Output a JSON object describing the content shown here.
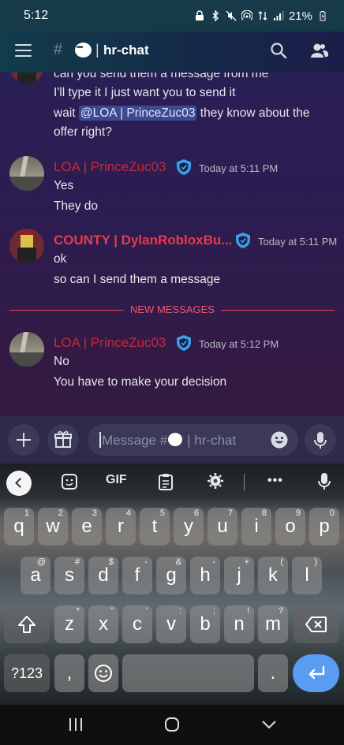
{
  "status_bar": {
    "time": "5:12",
    "battery": "21%"
  },
  "header": {
    "channel_name": "hr-chat",
    "separator": "|"
  },
  "chat": {
    "prev_lines": [
      "can you send them a message from me",
      "I'll type it I just want you to send it",
      "wait",
      "@LOA | PrinceZuc03",
      "they know about the",
      "offer right?"
    ],
    "messages": [
      {
        "author": "LOA | PrinceZuc03",
        "time": "Today at 5:11 PM",
        "lines": [
          "Yes",
          "They do"
        ]
      },
      {
        "author": "COUNTY | DylanRobloxBu...",
        "time": "Today at 5:11 PM",
        "lines": [
          "ok",
          "so can I send them a message"
        ]
      },
      {
        "author": "LOA | PrinceZuc03",
        "time": "Today at 5:12 PM",
        "lines": [
          "No",
          "You have to make your decision"
        ]
      }
    ],
    "new_messages_label": "NEW MESSAGES"
  },
  "composer": {
    "placeholder_prefix": "Message #",
    "placeholder_channel": "| hr-chat"
  },
  "keyboard": {
    "toolbar": {
      "gif": "GIF",
      "more": "•••"
    },
    "row1": [
      {
        "k": "q",
        "h": "1"
      },
      {
        "k": "w",
        "h": "2"
      },
      {
        "k": "e",
        "h": "3"
      },
      {
        "k": "r",
        "h": "4"
      },
      {
        "k": "t",
        "h": "5"
      },
      {
        "k": "y",
        "h": "6"
      },
      {
        "k": "u",
        "h": "7"
      },
      {
        "k": "i",
        "h": "8"
      },
      {
        "k": "o",
        "h": "9"
      },
      {
        "k": "p",
        "h": "0"
      }
    ],
    "row2": [
      {
        "k": "a",
        "h": "@"
      },
      {
        "k": "s",
        "h": "#"
      },
      {
        "k": "d",
        "h": "$"
      },
      {
        "k": "f",
        "h": "-"
      },
      {
        "k": "g",
        "h": "&"
      },
      {
        "k": "h",
        "h": "-"
      },
      {
        "k": "j",
        "h": "+"
      },
      {
        "k": "k",
        "h": "("
      },
      {
        "k": "l",
        "h": ")"
      }
    ],
    "row3": [
      {
        "k": "z",
        "h": "*"
      },
      {
        "k": "x",
        "h": "\""
      },
      {
        "k": "c",
        "h": "'"
      },
      {
        "k": "v",
        "h": ":"
      },
      {
        "k": "b",
        "h": ";"
      },
      {
        "k": "n",
        "h": "!"
      },
      {
        "k": "m",
        "h": "?"
      }
    ],
    "sym_key": "?123",
    "comma": ",",
    "period": "."
  },
  "colors": {
    "accent": "#5a9cf2",
    "author": "#c4283b",
    "new_messages": "#f05a60"
  }
}
